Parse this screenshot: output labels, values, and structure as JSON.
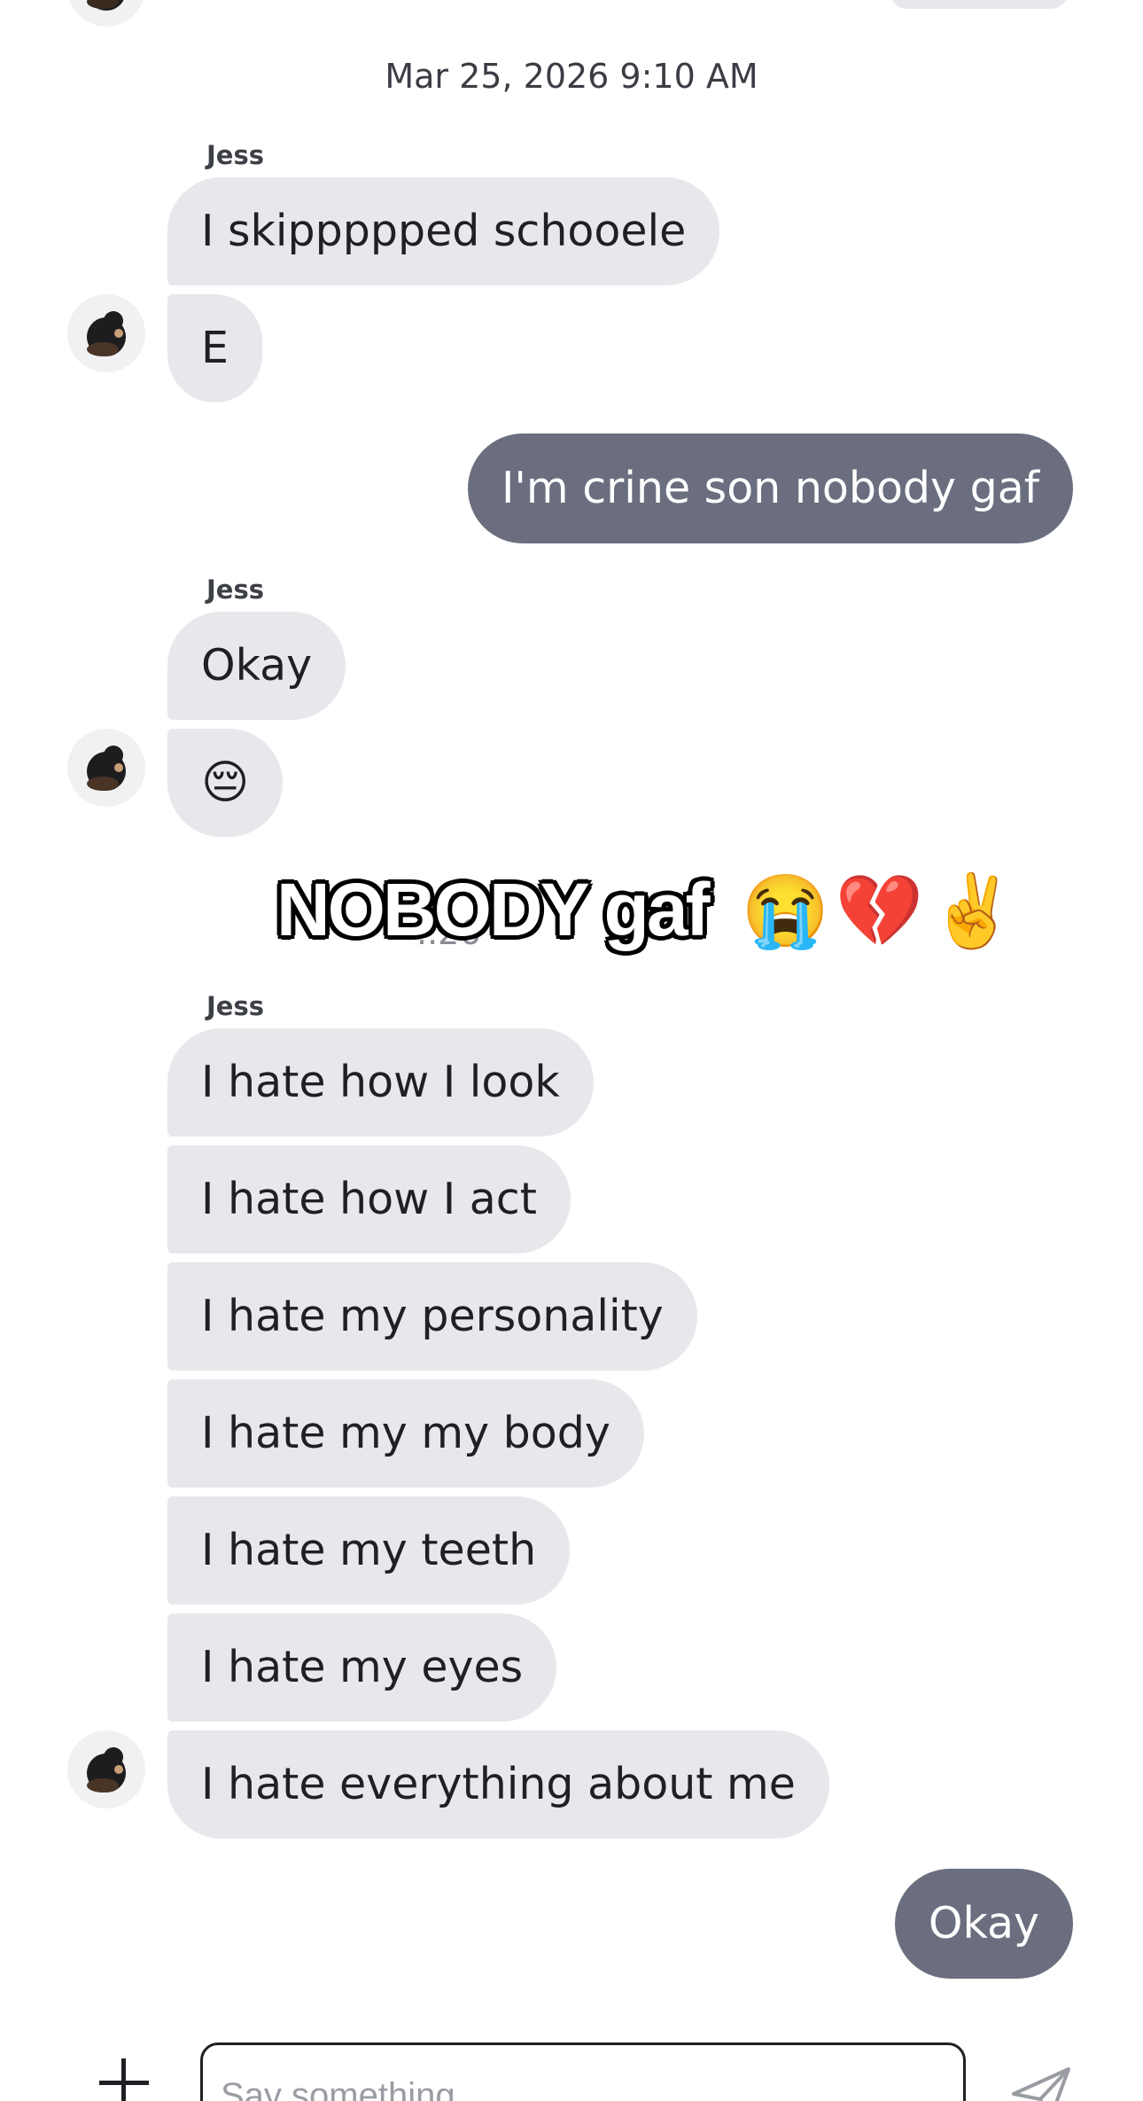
{
  "timestamp": "Mar 25, 2026 9:10 AM",
  "sender_name": "Jess",
  "group1": [
    "I skippppped schooele",
    "E"
  ],
  "outgoing1": "I'm crine son nobody gaf",
  "group2": [
    "Okay",
    "😔"
  ],
  "overlay": {
    "caption": "NOBODY gaf",
    "emojis": "😭💔✌️",
    "ghost_date": "..26"
  },
  "group3": [
    "I hate how I look",
    "I hate how I act",
    "I hate my personality",
    "I hate my my body",
    "I hate my teeth",
    "I hate my eyes",
    "I hate everything about me"
  ],
  "outgoing2": "Okay",
  "composer": {
    "placeholder": "Say something",
    "add_icon": "plus-icon",
    "send_icon": "send-icon"
  },
  "colors": {
    "incoming_bubble": "#e8e8ec",
    "outgoing_bubble": "#6b6e7f"
  }
}
